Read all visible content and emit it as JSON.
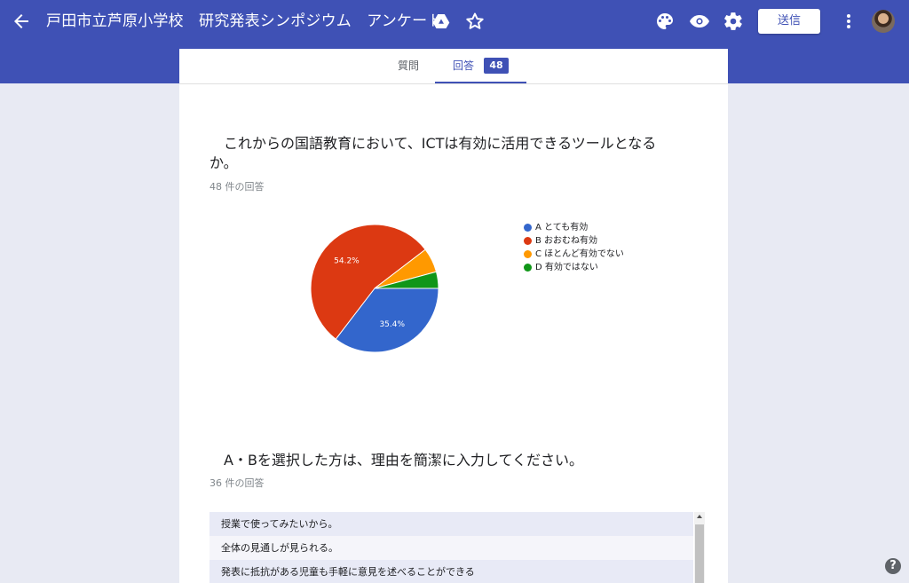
{
  "header": {
    "title": "戸田市立芦原小学校　研究発表シンポジウム　アンケート",
    "send_label": "送信",
    "icons": [
      "arrow-back-icon",
      "drive-icon",
      "star-icon",
      "palette-icon",
      "eye-icon",
      "gear-icon",
      "more-vert-icon"
    ],
    "bg_color": "#3f51b5"
  },
  "tabs": {
    "questions_label": "質問",
    "responses_label": "回答",
    "responses_count": "48"
  },
  "question1": {
    "text": "これからの国語教育において、ICTは有効に活用できるツールとなるか。",
    "count_text": "48 件の回答"
  },
  "chart_data": {
    "type": "pie",
    "labels": [
      "A とても有効",
      "B おおむね有効",
      "C ほとんど有効でない",
      "D 有効ではない"
    ],
    "values": [
      35.4,
      54.2,
      6.2,
      4.2
    ],
    "colors": [
      "#3366cc",
      "#dc3912",
      "#ff9900",
      "#109618"
    ],
    "data_labels": [
      "35.4%",
      "54.2%",
      "",
      ""
    ],
    "legend_position": "right"
  },
  "question2": {
    "text": "A・Bを選択した方は、理由を簡潔に入力してください。",
    "count_text": "36 件の回答",
    "responses": [
      "授業で使ってみたいから。",
      "全体の見通しが見られる。",
      "発表に抵抗がある児童も手軽に意見を述べることができる"
    ]
  }
}
